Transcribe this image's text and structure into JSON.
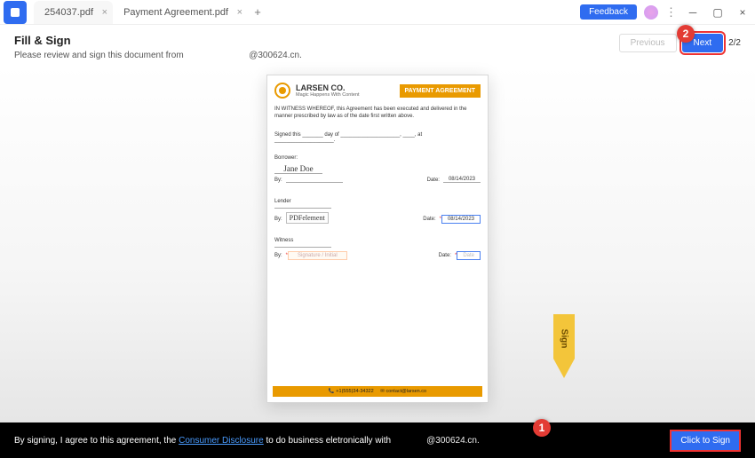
{
  "tabs": [
    {
      "label": "254037.pdf",
      "active": false
    },
    {
      "label": "Payment Agreement.pdf",
      "active": true
    }
  ],
  "titlebar": {
    "feedback": "Feedback"
  },
  "fillsign": {
    "title": "Fill & Sign",
    "desc_prefix": "Please review and sign this document from",
    "desc_sender": "@300624.cn.",
    "prev": "Previous",
    "next": "Next",
    "page": "2/2"
  },
  "badges": {
    "one": "1",
    "two": "2"
  },
  "doc": {
    "company": "LARSEN CO.",
    "tagline": "Magic Happens With Content",
    "banner": "PAYMENT AGREEMENT",
    "witness_whereof": "IN WITNESS WHEREOF, this Agreement has been executed and delivered in the manner prescribed by law as of the date first written above.",
    "signed_this": "Signed this _______ day of ____________________, ____, at ____________________.",
    "borrower_label": "Borrower:",
    "borrower_name": "Jane Doe",
    "by_label": "By:",
    "date_label": "Date:",
    "borrower_date": "08/14/2023",
    "lender_label": "Lender",
    "lender_name": "PDFelement",
    "lender_date": "08/14/2023",
    "witness_label": "Witness",
    "witness_name": "Signature / Initial",
    "witness_date": "Date",
    "footer_phone": "+1(555)34-34322",
    "footer_email": "contact@larsen.co"
  },
  "arrow": {
    "label": "Sign"
  },
  "bottombar": {
    "text_prefix": "By signing, I agree to this agreement, the ",
    "disclosure": "Consumer Disclosure",
    "text_suffix": " to do business eletronically with",
    "sender": "@300624.cn.",
    "cts": "Click to Sign"
  }
}
